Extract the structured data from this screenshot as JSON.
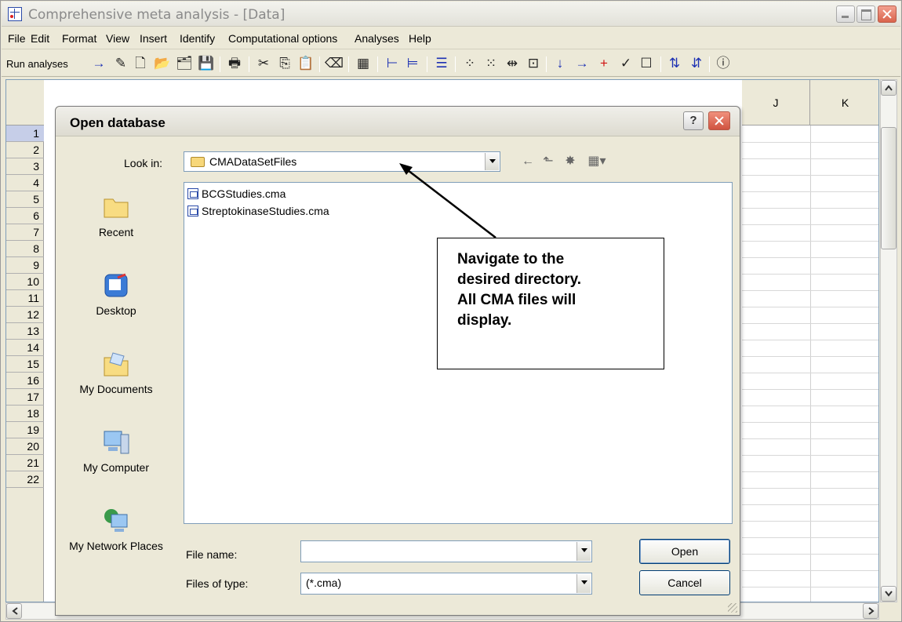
{
  "app": {
    "title": "Comprehensive meta analysis - [Data]"
  },
  "menu": [
    "File",
    "Edit",
    "Format",
    "View",
    "Insert",
    "Identify",
    "Computational options",
    "Analyses",
    "Help"
  ],
  "toolbar": {
    "run_label": "Run analyses"
  },
  "grid": {
    "rows": [
      "1",
      "2",
      "3",
      "4",
      "5",
      "6",
      "7",
      "8",
      "9",
      "10",
      "11",
      "12",
      "13",
      "14",
      "15",
      "16",
      "17",
      "18",
      "19",
      "20",
      "21",
      "22"
    ],
    "columns": [
      "J",
      "K"
    ]
  },
  "dialog": {
    "title": "Open database",
    "help": "?",
    "look_in_label": "Look in:",
    "look_in_value": "CMADataSetFiles",
    "places": [
      "Recent",
      "Desktop",
      "My Documents",
      "My Computer",
      "My Network Places"
    ],
    "files": [
      "BCGStudies.cma",
      "StreptokinaseStudies.cma"
    ],
    "file_name_label": "File name:",
    "file_name_value": "",
    "file_type_label": "Files of type:",
    "file_type_value": "(*.cma)",
    "open_label": "Open",
    "cancel_label": "Cancel"
  },
  "callout": {
    "text": "Navigate to the\ndesired directory.\nAll CMA files will\ndisplay."
  }
}
